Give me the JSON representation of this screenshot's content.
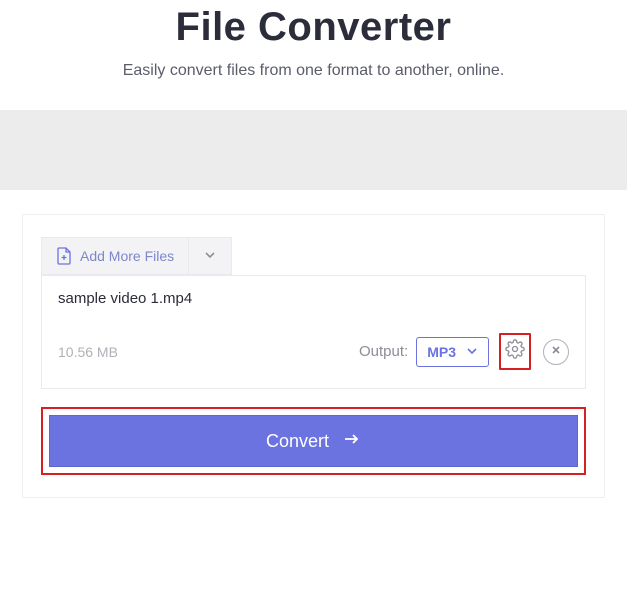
{
  "header": {
    "title": "File Converter",
    "subtitle": "Easily convert files from one format to another, online."
  },
  "toolbar": {
    "add_more_label": "Add More Files"
  },
  "file": {
    "name": "sample video 1.mp4",
    "size": "10.56 MB",
    "output_label": "Output:",
    "format": "MP3"
  },
  "actions": {
    "convert_label": "Convert"
  }
}
